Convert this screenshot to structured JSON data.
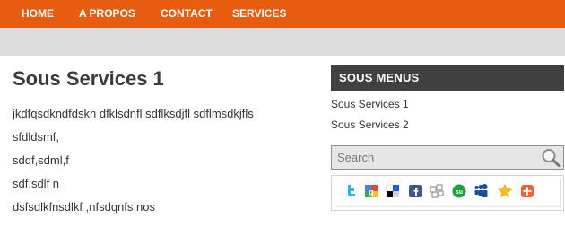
{
  "nav": {
    "items": [
      {
        "label": "HOME"
      },
      {
        "label": "A PROPOS"
      },
      {
        "label": "CONTACT"
      },
      {
        "label": "SERVICES"
      }
    ]
  },
  "main": {
    "title": "Sous Services 1",
    "paragraphs": [
      "jkdfqsdkndfdskn dfklsdnfl sdflksdjfl sdflmsdkjfls",
      "sfdldsmf,",
      "sdqf,sdml,f",
      "sdf,sdlf n",
      "dsfsdlkfnsdlkf ,nfsdqnfs nos"
    ]
  },
  "sidebar": {
    "heading": "SOUS MENUS",
    "links": [
      {
        "label": "Sous Services 1"
      },
      {
        "label": "Sous Services 2"
      }
    ],
    "search": {
      "placeholder": "Search",
      "value": ""
    }
  },
  "share_icons": [
    "twitter-icon",
    "google-bookmarks-icon",
    "delicious-icon",
    "facebook-icon",
    "digg-icon",
    "stumbleupon-icon",
    "myspace-icon",
    "favorite-star-icon",
    "add-more-icon"
  ],
  "colors": {
    "nav_bg": "#e85c0f",
    "subbar_bg": "#dcdcdc",
    "sidebar_heading_bg": "#404040",
    "text": "#333333"
  }
}
